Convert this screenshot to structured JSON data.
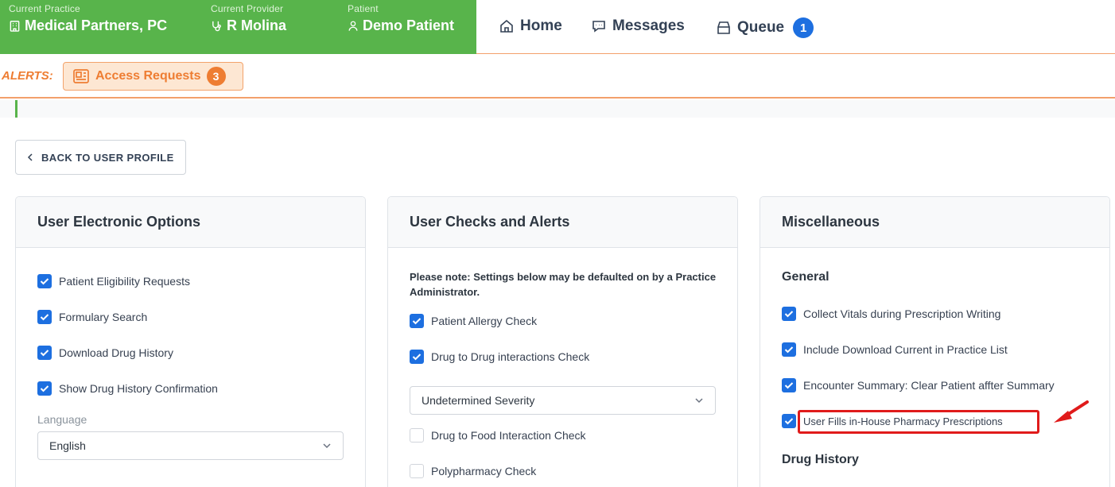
{
  "context": {
    "practice": {
      "caption": "Current Practice",
      "value": "Medical Partners, PC"
    },
    "provider": {
      "caption": "Current Provider",
      "value": "R Molina"
    },
    "patient": {
      "caption": "Patient",
      "value": "Demo Patient"
    }
  },
  "nav": {
    "home": "Home",
    "messages": "Messages",
    "queue": "Queue",
    "queue_count": "1"
  },
  "alerts": {
    "label": "ALERTS:",
    "access_requests": "Access Requests",
    "access_requests_count": "3"
  },
  "back_button": "BACK TO USER PROFILE",
  "electronic_options": {
    "title": "User Electronic Options",
    "items": [
      {
        "label": "Patient Eligibility Requests",
        "checked": true
      },
      {
        "label": "Formulary Search",
        "checked": true
      },
      {
        "label": "Download Drug History",
        "checked": true
      },
      {
        "label": "Show Drug History Confirmation",
        "checked": true
      }
    ],
    "language_label": "Language",
    "language_value": "English"
  },
  "checks_alerts": {
    "title": "User Checks and Alerts",
    "note": "Please note: Settings below may be defaulted on by a Practice Administrator.",
    "items": [
      {
        "label": "Patient Allergy Check",
        "checked": true
      },
      {
        "label": "Drug to Drug interactions Check",
        "checked": true
      }
    ],
    "severity_value": "Undetermined Severity",
    "more_items": [
      {
        "label": "Drug to Food Interaction Check",
        "checked": false
      },
      {
        "label": "Polypharmacy Check",
        "checked": false
      }
    ]
  },
  "miscellaneous": {
    "title": "Miscellaneous",
    "general_title": "General",
    "items": [
      {
        "label": "Collect Vitals during Prescription Writing",
        "checked": true
      },
      {
        "label": "Include Download Current in Practice List",
        "checked": true
      },
      {
        "label": "Encounter Summary: Clear Patient affter Summary",
        "checked": true
      },
      {
        "label": "User Fills in-House Pharmacy Prescriptions",
        "checked": true
      }
    ],
    "drug_history_title": "Drug History"
  },
  "colors": {
    "brand_green": "#58b44b",
    "accent_orange": "#ee7d32",
    "checkbox_blue": "#1d6fe0",
    "highlight_red": "#e01b1b"
  }
}
